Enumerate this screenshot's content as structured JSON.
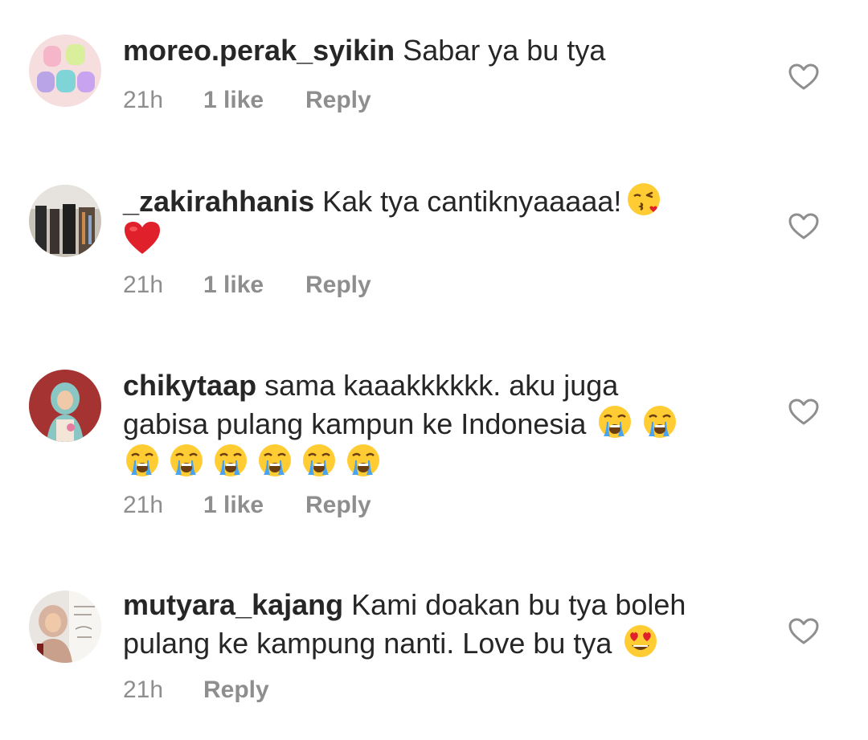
{
  "comments": [
    {
      "username": "moreo.perak_syikin",
      "text": "Sabar ya bu tya",
      "time": "21h",
      "likes": "1 like",
      "reply": "Reply",
      "avatar_icon": "pastel-beauty-device-photo"
    },
    {
      "username": "_zakirahhanis",
      "text": "Kak tya cantiknyaaaaa!",
      "emojis": [
        "face-blowing-kiss-emoji",
        "red-heart-emoji"
      ],
      "time": "21h",
      "likes": "1 like",
      "reply": "Reply",
      "avatar_icon": "clothing-store-photo"
    },
    {
      "username": "chikytaap",
      "text_line1": "sama kaaakkkkkk. aku juga",
      "text_line2": "gabisa pulang kampun ke Indonesia",
      "emojis": [
        "loudly-crying-face-emoji",
        "loudly-crying-face-emoji",
        "loudly-crying-face-emoji",
        "loudly-crying-face-emoji",
        "loudly-crying-face-emoji",
        "loudly-crying-face-emoji",
        "loudly-crying-face-emoji",
        "loudly-crying-face-emoji"
      ],
      "time": "21h",
      "likes": "1 like",
      "reply": "Reply",
      "avatar_icon": "hijab-woman-photo"
    },
    {
      "username": "mutyara_kajang",
      "text_line1": "Kami doakan bu tya boleh",
      "text_line2": "pulang ke kampung nanti. Love bu tya",
      "emojis": [
        "heart-eyes-face-emoji"
      ],
      "time": "21h",
      "reply": "Reply",
      "avatar_icon": "hijab-woman-card-photo"
    }
  ],
  "colors": {
    "text": "#262626",
    "secondary": "#8e8e8e",
    "heart_outline": "#8e8e8e",
    "emoji_yellow": "#ffcc33",
    "emoji_red": "#e0202a",
    "tear_blue": "#4aa3f0"
  }
}
